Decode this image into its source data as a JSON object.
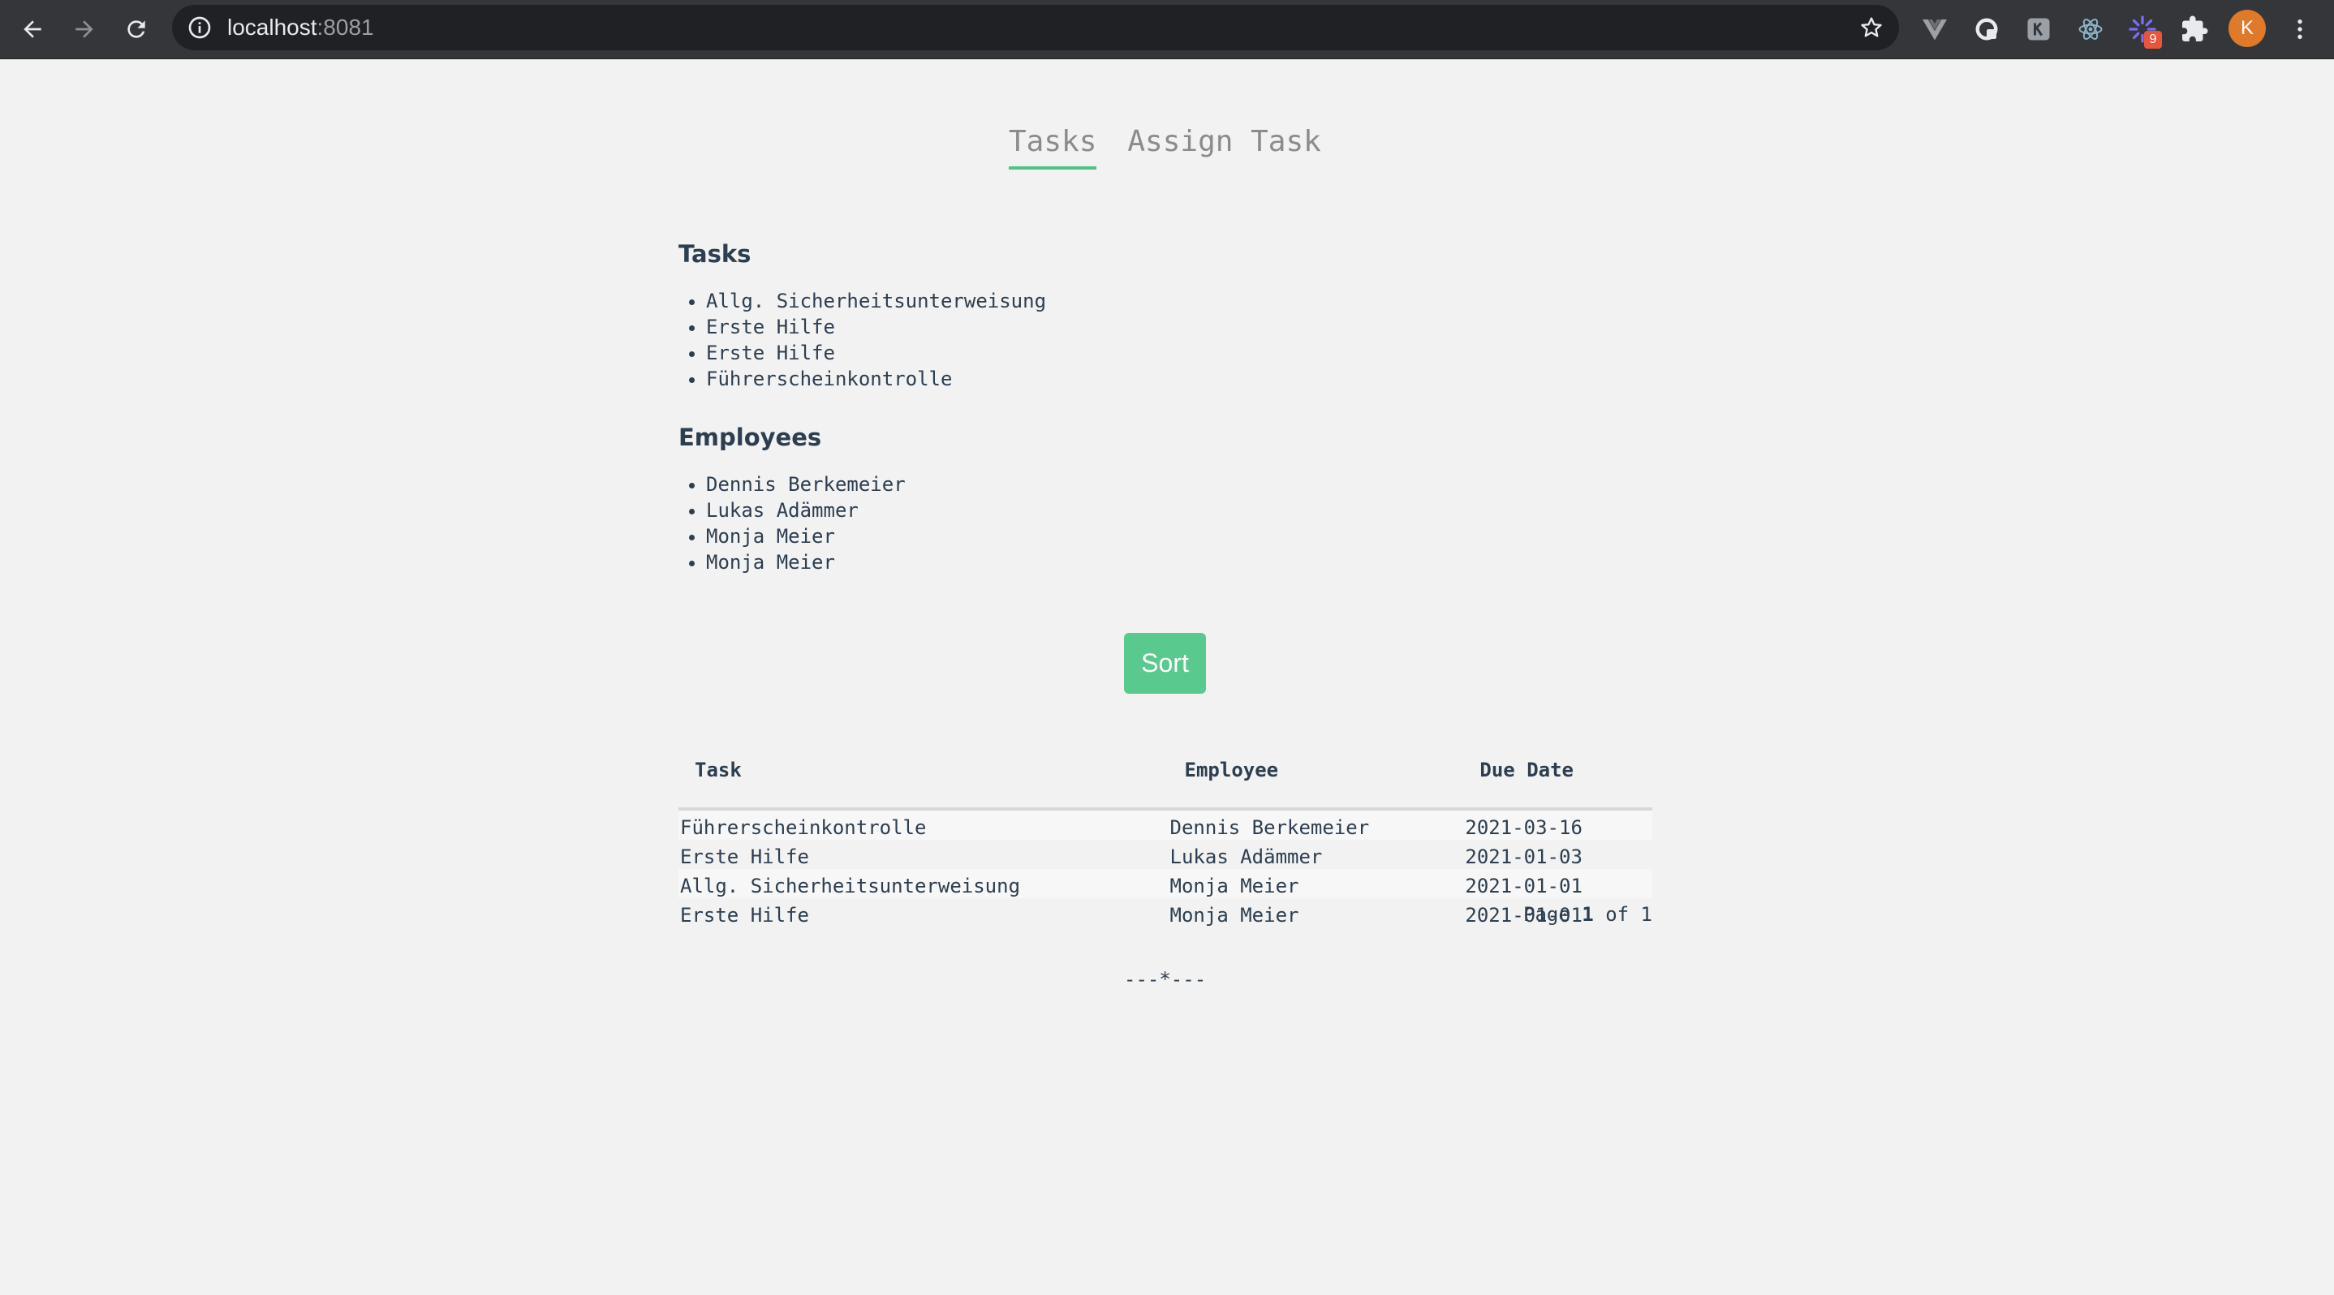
{
  "browser": {
    "url_host": "localhost",
    "url_port": ":8081",
    "profile_initial": "K",
    "extension_badge": "9"
  },
  "nav": {
    "tabs": [
      {
        "label": "Tasks",
        "active": true
      },
      {
        "label": "Assign Task",
        "active": false
      }
    ]
  },
  "tasks_section": {
    "heading": "Tasks",
    "items": [
      "Allg. Sicherheitsunterweisung",
      "Erste Hilfe",
      "Erste Hilfe",
      "Führerscheinkontrolle"
    ]
  },
  "employees_section": {
    "heading": "Employees",
    "items": [
      "Dennis Berkemeier",
      "Lukas Adämmer",
      "Monja Meier",
      "Monja Meier"
    ]
  },
  "sort_button": {
    "label": "Sort",
    "color": "#59c98e"
  },
  "table": {
    "headers": {
      "task": "Task",
      "employee": "Employee",
      "due": "Due Date"
    },
    "rows": [
      {
        "task": "Führerscheinkontrolle",
        "employee": "Dennis Berkemeier",
        "due": "2021-03-16"
      },
      {
        "task": "Erste Hilfe",
        "employee": "Lukas Adämmer",
        "due": "2021-01-03"
      },
      {
        "task": "Allg. Sicherheitsunterweisung",
        "employee": "Monja Meier",
        "due": "2021-01-01"
      },
      {
        "task": "Erste Hilfe",
        "employee": "Monja Meier",
        "due": "2021-01-01"
      }
    ]
  },
  "pager": {
    "prefix": "Page",
    "current": "1",
    "sep": "of",
    "total": "1"
  },
  "footer": {
    "divider": "---*---"
  },
  "colors": {
    "accent": "#4fc389",
    "text": "#2c3e50",
    "background": "#f2f2f2"
  }
}
